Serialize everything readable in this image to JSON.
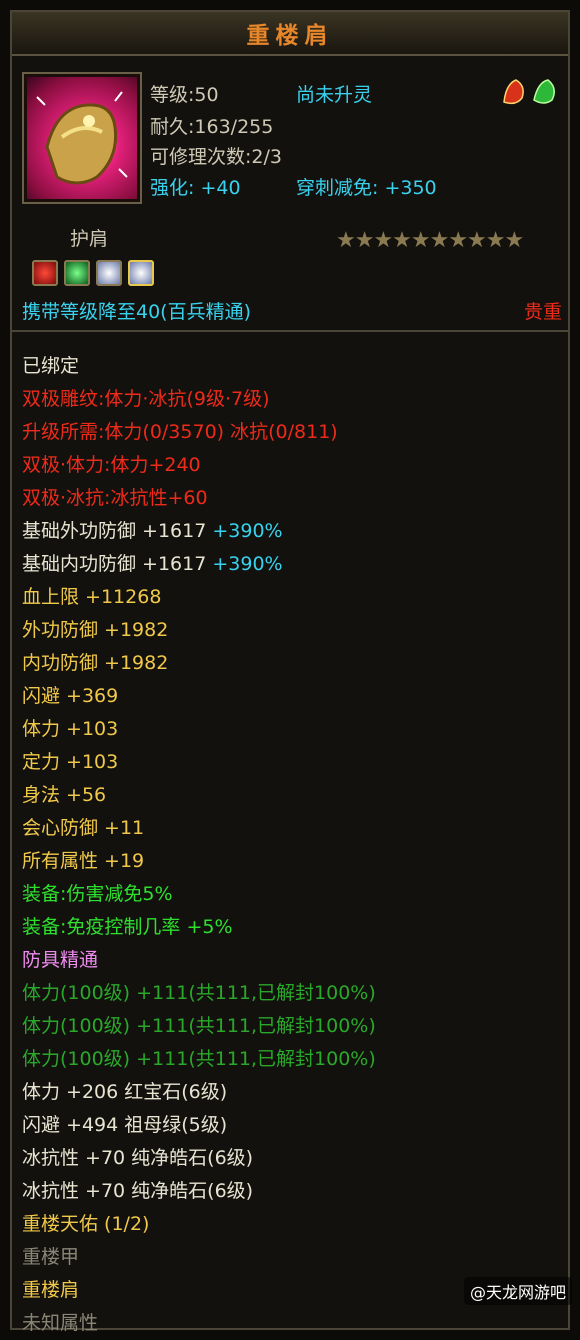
{
  "title": "重楼肩",
  "header": {
    "level": "等级:50",
    "spirit_status": "尚未升灵",
    "durability": "耐久:163/255",
    "repair_count": "可修理次数:2/3",
    "strengthen": "强化: +40",
    "pierce_reduction": "穿刺减免: +350"
  },
  "item_type": "护肩",
  "stars": "★★★★★★★★★★",
  "carry_level": "携带等级降至40(百兵精通)",
  "rarity": "贵重",
  "icons": {
    "art": "shoulder-armor-icon",
    "badges": [
      "red-badge-icon",
      "green-badge-icon"
    ],
    "gems": [
      "ruby-gem-icon",
      "emerald-gem-icon",
      "diamond-gem-icon",
      "diamond-gem-icon"
    ]
  },
  "colors": {
    "white": "#e8e4d2",
    "red": "#ee2a1a",
    "yellow": "#f0c84a",
    "cyan": "#39d2ee",
    "green": "#2ee02e",
    "pink": "#f08cf0",
    "dark_green": "#2aa82a",
    "gray": "#8a8676"
  },
  "attributes": [
    {
      "text": "已绑定",
      "color": "#e8e4d2"
    },
    {
      "text": "双极雕纹:体力·冰抗(9级·7级)",
      "color": "#ee2a1a"
    },
    {
      "text": "升级所需:体力(0/3570) 冰抗(0/811)",
      "color": "#ee2a1a"
    },
    {
      "text": "双极·体力:体力+240",
      "color": "#ee2a1a"
    },
    {
      "text": "双极·冰抗:冰抗性+60",
      "color": "#ee2a1a"
    },
    {
      "text": "基础外功防御 +1617",
      "color": "#e8e4d2",
      "extra": " +390%"
    },
    {
      "text": "基础内功防御 +1617",
      "color": "#e8e4d2",
      "extra": " +390%"
    },
    {
      "text": "血上限 +11268",
      "color": "#f0c84a"
    },
    {
      "text": "外功防御 +1982",
      "color": "#f0c84a"
    },
    {
      "text": "内功防御 +1982",
      "color": "#f0c84a"
    },
    {
      "text": "闪避 +369",
      "color": "#f0c84a"
    },
    {
      "text": "体力 +103",
      "color": "#f0c84a"
    },
    {
      "text": "定力 +103",
      "color": "#f0c84a"
    },
    {
      "text": "身法 +56",
      "color": "#f0c84a"
    },
    {
      "text": "会心防御 +11",
      "color": "#f0c84a"
    },
    {
      "text": "所有属性 +19",
      "color": "#f0c84a"
    },
    {
      "text": "装备:伤害减免5%",
      "color": "#2ee02e"
    },
    {
      "text": "装备:免疫控制几率 +5%",
      "color": "#2ee02e"
    },
    {
      "text": "防具精通",
      "color": "#f08cf0"
    },
    {
      "text": "体力(100级) +111(共111,已解封100%)",
      "color": "#2aa82a"
    },
    {
      "text": "体力(100级) +111(共111,已解封100%)",
      "color": "#2aa82a"
    },
    {
      "text": "体力(100级) +111(共111,已解封100%)",
      "color": "#2aa82a"
    },
    {
      "text": "体力 +206 红宝石(6级)",
      "color": "#e8e4d2"
    },
    {
      "text": "闪避 +494 祖母绿(5级)",
      "color": "#e8e4d2"
    },
    {
      "text": "冰抗性 +70 纯净皓石(6级)",
      "color": "#e8e4d2"
    },
    {
      "text": "冰抗性 +70 纯净皓石(6级)",
      "color": "#e8e4d2"
    },
    {
      "text": "重楼天佑 (1/2)",
      "color": "#f0c84a"
    },
    {
      "text": "重楼甲",
      "color": "#8a8676"
    },
    {
      "text": "重楼肩",
      "color": "#f0c84a"
    },
    {
      "text": "未知属性",
      "color": "#8a8676"
    }
  ],
  "watermark": "@天龙网游吧"
}
